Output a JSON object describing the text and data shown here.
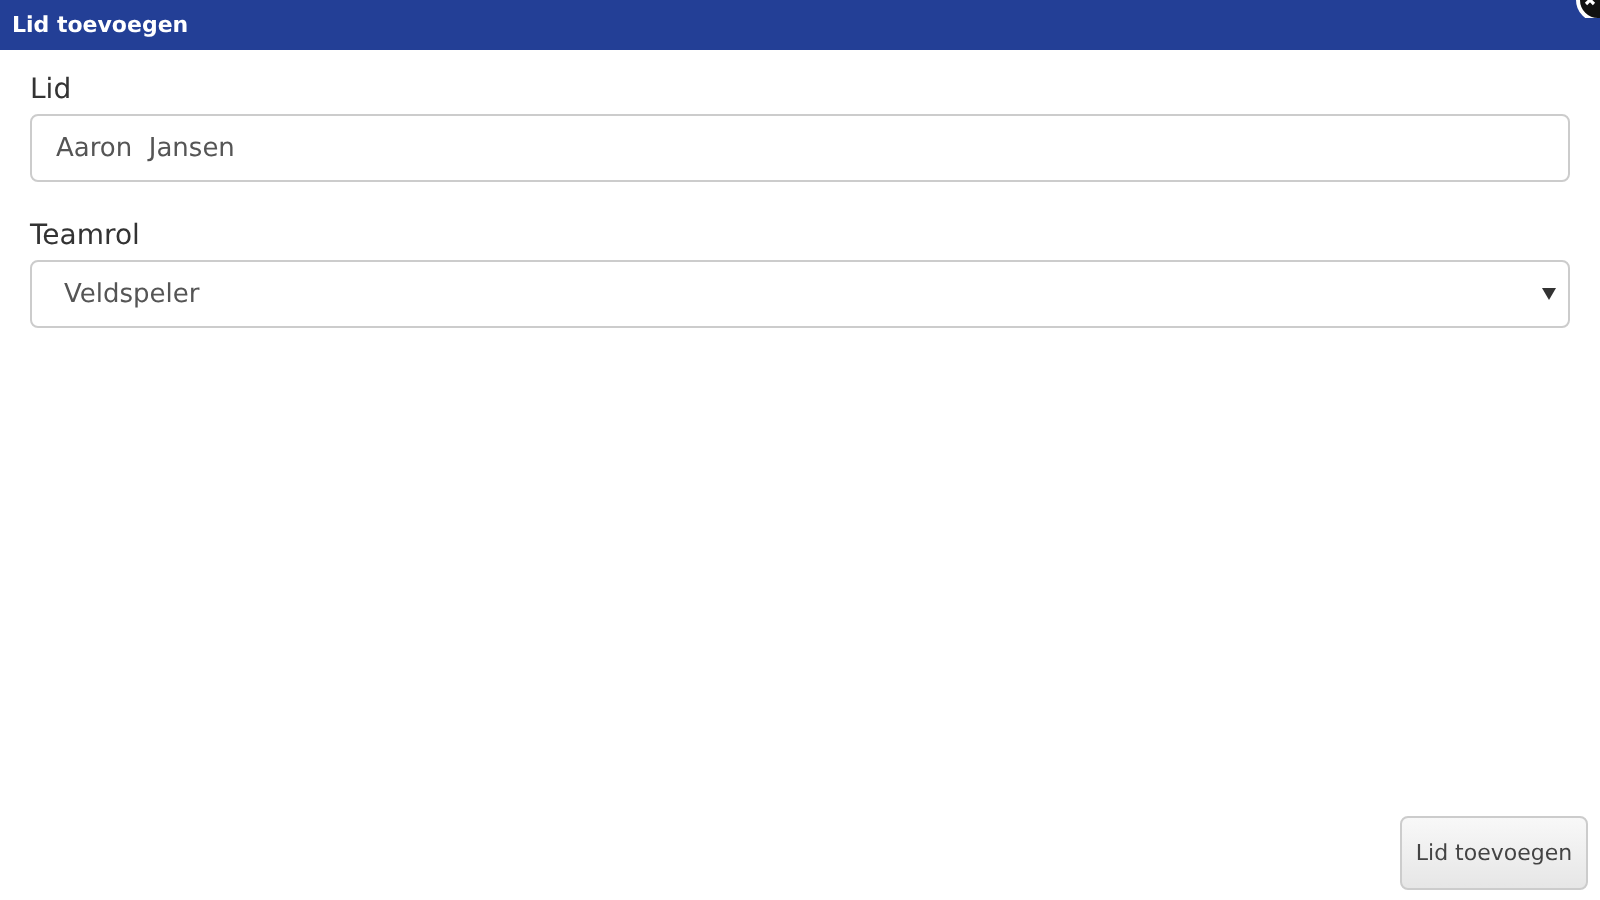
{
  "window": {
    "title": "Lid toevoegen"
  },
  "fields": [
    {
      "kind": "text",
      "label": "Lid",
      "value": "Aaron  Jansen"
    },
    {
      "kind": "select",
      "label": "Teamrol",
      "value": "Veldspeler"
    }
  ],
  "buttons": [
    "Lid toevoegen"
  ]
}
